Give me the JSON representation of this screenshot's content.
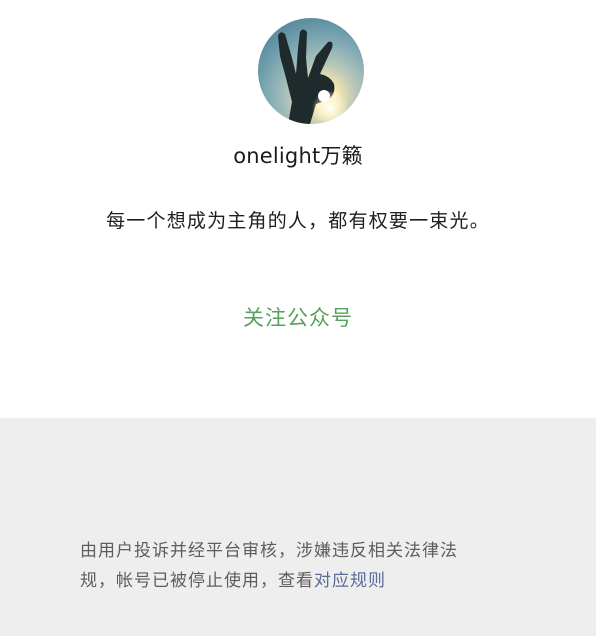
{
  "profile": {
    "avatar_icon": "hand-ok-sunlight-avatar",
    "name": "onelight万籁",
    "bio": "每一个想成为主角的人，都有权要一束光。"
  },
  "actions": {
    "follow_label": "关注公众号"
  },
  "notice": {
    "line1": "由用户投诉并经平台审核，涉嫌违反相关法律法",
    "line2_prefix": "规，帐号已被停止使用，查看",
    "rules_link": "对应规则"
  },
  "colors": {
    "follow": "#57a05d",
    "link": "#5a6b97",
    "notice_bg": "#eeeeee"
  }
}
